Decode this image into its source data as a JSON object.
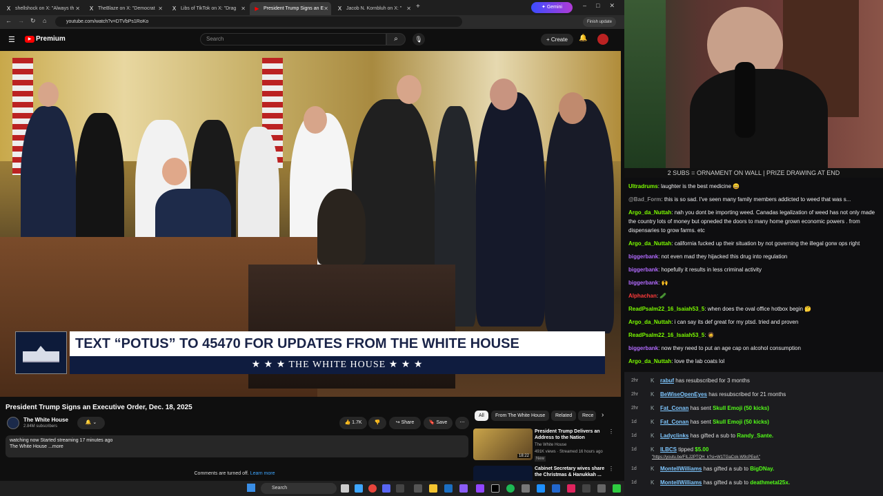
{
  "browser": {
    "tabs": [
      {
        "label": "shellshock on X: \"Always th",
        "icon": "x-icon"
      },
      {
        "label": "TheBlaze on X: \"Democrat",
        "icon": "x-icon"
      },
      {
        "label": "Libs of TikTok on X: \"Drag",
        "icon": "x-icon"
      },
      {
        "label": "President Trump Signs an E",
        "icon": "youtube-icon",
        "active": true
      },
      {
        "label": "Jacob N. Kornbluh on X: \"",
        "icon": "x-icon"
      }
    ],
    "gemini_label": "Gemini",
    "url": "youtube.com/watch?v=DTVbPs1RoKo",
    "finish_update": "Finish update"
  },
  "youtube": {
    "logo": "Premium",
    "search_placeholder": "Search",
    "create_label": "Create",
    "banner_top": "TEXT “POTUS” TO 45470 FOR UPDATES FROM THE WHITE HOUSE",
    "banner_bottom": "★ ★ ★  THE WHITE HOUSE  ★ ★ ★",
    "video_title": "President Trump Signs an Executive Order, Dec. 18, 2025",
    "channel": "The White House",
    "subscribers": "2.84M subscribers",
    "likes": "1.7K",
    "share": "Share",
    "save": "Save",
    "desc_line1": "watching now  Started streaming 17 minutes ago",
    "desc_line2": "The White House ...more",
    "comments_off": "Comments are turned off.",
    "learn_more": "Learn more",
    "chips": [
      "All",
      "From The White House",
      "Related",
      "Rece"
    ],
    "recs": [
      {
        "title": "President Trump Delivers an Address to the Nation",
        "channel": "The White House",
        "meta": "491K views · Streamed 16 hours ago",
        "badge": "New",
        "duration": "18:22"
      },
      {
        "title": "Cabinet Secretary wives share the Christmas & Hanukkah ...",
        "channel": "",
        "meta": "",
        "badge": "",
        "duration": ""
      }
    ]
  },
  "stream": {
    "overlay_header": "2 SUBS = ORNAMENT ON WALL | PRIZE DRAWING AT END",
    "chat": [
      {
        "user": "Ultradrums",
        "color": "#7cfc00",
        "text": "laughter is the best medicine 😄"
      },
      {
        "user": "@Bad_Form",
        "color": "#888888",
        "text": "this is so sad. I've seen many family members addicted to weed that was s..."
      },
      {
        "user": "Argo_da_Nuttah",
        "color": "#7cfc00",
        "text": "nah you dont be importing weed. Canadas legalization of weed has not only made the country lots of money but opneded the doors to many home grown economic powers . from dispensaries to grow farms. etc"
      },
      {
        "user": "Argo_da_Nuttah",
        "color": "#7cfc00",
        "text": "california fucked up their situation by not governing the illegal gorw ops right"
      },
      {
        "user": "biggerbank",
        "color": "#b36bff",
        "text": "not even mad they hijacked this drug into regulation"
      },
      {
        "user": "biggerbank",
        "color": "#b36bff",
        "text": "hopefully it results in less criminal activity"
      },
      {
        "user": "biggerbank",
        "color": "#b36bff",
        "text": "🙌"
      },
      {
        "user": "Alphachan",
        "color": "#ff3b3b",
        "text": "🥒"
      },
      {
        "user": "ReadPsalm22_16_Isaiah53_5",
        "color": "#7cfc00",
        "text": "when does the oval office hotbox begin 🤔"
      },
      {
        "user": "Argo_da_Nuttah",
        "color": "#7cfc00",
        "text": "i can say its def great for my ptsd. tried and proven"
      },
      {
        "user": "ReadPsalm22_16_Isaiah53_5",
        "color": "#7cfc00",
        "text": "🧔"
      },
      {
        "user": "biggerbank",
        "color": "#b36bff",
        "text": "now they need to put an age cap on alcohol consumption"
      },
      {
        "user": "Argo_da_Nuttah",
        "color": "#7cfc00",
        "text": "love the lab coats lol"
      }
    ],
    "events": [
      {
        "time": "2hr",
        "name": "rabuf",
        "text": "has resubscribed for 3 months",
        "extra": ""
      },
      {
        "time": "2hr",
        "name": "BeWiseOpenEyes",
        "text": "has resubscribed for 21 months",
        "extra": ""
      },
      {
        "time": "2hr",
        "name": "Fat_Conan",
        "text": "has sent",
        "extra": "Skull Emoji (50 kicks)"
      },
      {
        "time": "1d",
        "name": "Fat_Conan",
        "text": "has sent",
        "extra": "Skull Emoji (50 kicks)"
      },
      {
        "time": "1d",
        "name": "Ladyclinks",
        "text": "has gifted a sub to",
        "extra": "Randy_Sante."
      },
      {
        "time": "1d",
        "name": "ILBCS",
        "text": "tipped",
        "extra": "$5.00"
      },
      {
        "time": "1d",
        "name": "MontellWilliams",
        "text": "has gifted a sub to",
        "extra": "BigDNay."
      },
      {
        "time": "1d",
        "name": "MontellWilliams",
        "text": "has gifted a sub to",
        "extra": "deathmetal25x."
      }
    ],
    "tip_link": "\"https://youtu.be/FILJ2PTQH_k?si=W1TGaCok-W9cPEeA\""
  },
  "taskbar": {
    "search": "Search"
  }
}
